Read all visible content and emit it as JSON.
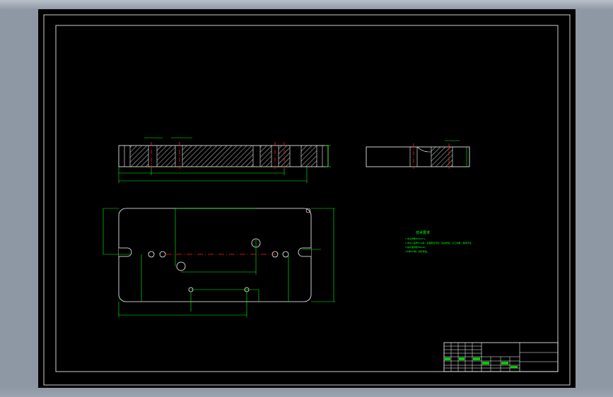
{
  "drawing": {
    "background": "#000000",
    "line_color": "#ffffff",
    "dim_color": "#00ff00",
    "center_color": "#ff0000",
    "text_color": "#00ff00"
  },
  "tech_req": {
    "title": "技术要求",
    "lines": [
      "1.未注倒角均为C0.5。",
      "2.未注公差按IT14级，表面需去毛刺，锐边倒钝，孔口倒角，保持清洁。",
      "3.热处理调质HRC40。",
      "4.材料45钢，涂防锈油。"
    ]
  }
}
